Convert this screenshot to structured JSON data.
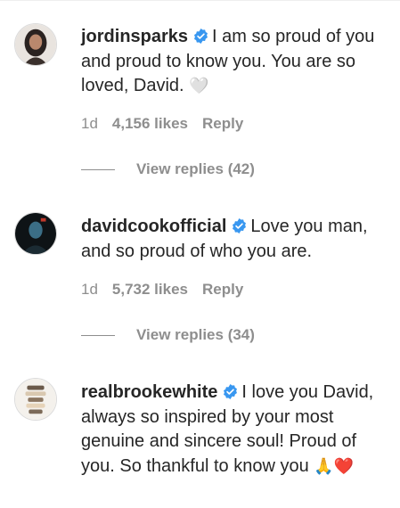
{
  "comments": [
    {
      "username": "jordinsparks",
      "text": "I am so proud of you and proud to know you. You are so loved, David.",
      "emoji": "🤍",
      "time": "1d",
      "likes": "4,156 likes",
      "reply": "Reply",
      "view_replies": "View replies (42)"
    },
    {
      "username": "davidcookofficial",
      "text": "Love you man, and so proud of who you are.",
      "emoji": "",
      "time": "1d",
      "likes": "5,732 likes",
      "reply": "Reply",
      "view_replies": "View replies (34)"
    },
    {
      "username": "realbrookewhite",
      "text": "I love you David, always so inspired by your most genuine and sincere soul! Proud of you. So thankful to know you",
      "emoji": "🙏❤️"
    }
  ],
  "colors": {
    "verified_badge": "#3897f0",
    "secondary_text": "#8e8e8e",
    "primary_text": "#262626"
  }
}
